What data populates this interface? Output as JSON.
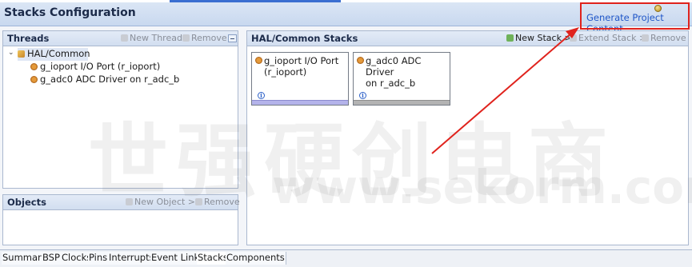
{
  "header": {
    "title": "Stacks Configuration",
    "generate_link": "Generate Project Content"
  },
  "threads_panel": {
    "title": "Threads",
    "new_thread": "New Thread",
    "remove": "Remove",
    "tree": {
      "root": "HAL/Common",
      "children": [
        "g_ioport I/O Port (r_ioport)",
        "g_adc0 ADC Driver on r_adc_b"
      ]
    }
  },
  "objects_panel": {
    "title": "Objects",
    "new_object": "New Object >",
    "remove": "Remove"
  },
  "stacks_panel": {
    "title": "HAL/Common Stacks",
    "new_stack": "New Stack >",
    "extend_stack": "Extend Stack >",
    "remove": "Remove",
    "cards": [
      {
        "line1": "g_ioport I/O Port",
        "line2": "(r_ioport)",
        "bar": "purple"
      },
      {
        "line1": "g_adc0 ADC Driver",
        "line2": "on r_adc_b",
        "bar": "gray"
      }
    ]
  },
  "bottom_tabs": [
    "Summary",
    "BSP",
    "Clocks",
    "Pins",
    "Interrupts",
    "Event Links",
    "Stacks",
    "Components"
  ],
  "watermark": {
    "cn": "世强硬创电商",
    "url": "www.sekorm.com"
  },
  "colors": {
    "accent_red": "#e0231d",
    "link_blue": "#1f56c8",
    "header_bg": "#c8d8ef"
  }
}
